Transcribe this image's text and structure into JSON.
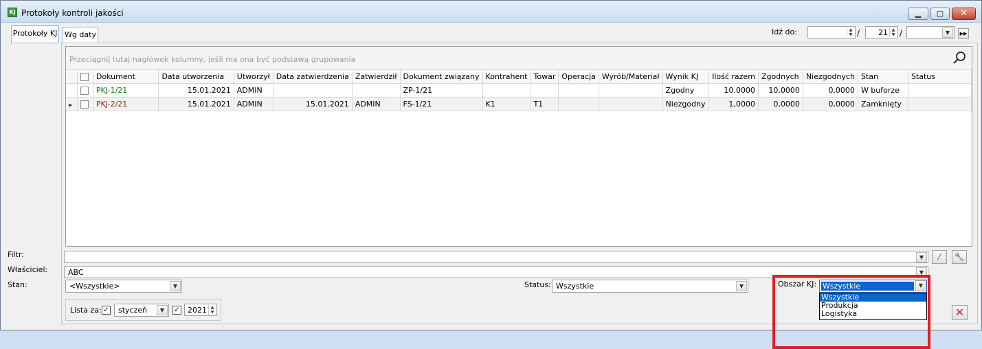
{
  "window": {
    "title": "Protokoły kontroli jakości",
    "app_icon": "KJ"
  },
  "tabs": {
    "vertical": "Protokoły KJ",
    "horizontal": "Wg daty"
  },
  "goto": {
    "label": "Idź do:",
    "month_value": "21",
    "day_value": "",
    "year_value": ""
  },
  "grid": {
    "group_hint": "Przeciągnij tutaj nagłówek kolumny, jeśli ma ona być podstawą grupowania",
    "columns": [
      "Dokument",
      "Data utworzenia",
      "Utworzył",
      "Data zatwierdzenia",
      "Zatwierdził",
      "Dokument związany",
      "Kontrahent",
      "Towar",
      "Operacja",
      "Wyrób/Materiał",
      "Wynik KJ",
      "Ilość razem",
      "Zgodnych",
      "Niezgodnych",
      "Stan",
      "Status"
    ],
    "rows": [
      {
        "dokument": "PKJ-1/21",
        "data_utworzenia": "15.01.2021",
        "utworzyl": "ADMIN",
        "data_zatwierdzenia": "",
        "zatwierdzil": "",
        "dokument_zwiazany": "ZP-1/21",
        "kontrahent": "",
        "towar": "",
        "operacja": "",
        "wyrob": "",
        "wynik": "Zgodny",
        "ilosc": "10,0000",
        "zgodnych": "10,0000",
        "niezgodnych": "0,0000",
        "stan": "W buforze",
        "status": ""
      },
      {
        "dokument": "PKJ-2/21",
        "data_utworzenia": "15.01.2021",
        "utworzyl": "ADMIN",
        "data_zatwierdzenia": "15.01.2021",
        "zatwierdzil": "ADMIN",
        "dokument_zwiazany": "FS-1/21",
        "kontrahent": "K1",
        "towar": "T1",
        "operacja": "",
        "wyrob": "",
        "wynik": "Niezgodny",
        "ilosc": "1,0000",
        "zgodnych": "0,0000",
        "niezgodnych": "0,0000",
        "stan": "Zamknięty",
        "status": ""
      }
    ]
  },
  "filters": {
    "filtr_label": "Filtr:",
    "filtr_value": "",
    "wlasciciel_label": "Właściciel:",
    "wlasciciel_value": "ABC",
    "stan_label": "Stan:",
    "stan_value": "<Wszystkie>",
    "status_label": "Status:",
    "status_value": "Wszystkie",
    "lista_za_label": "Lista za:",
    "month_value": "styczeń",
    "year_value": "2021",
    "obszar_label": "Obszar KJ:",
    "obszar_value": "Wszystkie",
    "obszar_options": [
      "Wszystkie",
      "Produkcja",
      "Logistyka"
    ]
  },
  "colors": {
    "accent": "#0a66cc",
    "highlight": "#e01c24",
    "green_doc": "#117a11",
    "red_doc": "#9a1a1a"
  }
}
